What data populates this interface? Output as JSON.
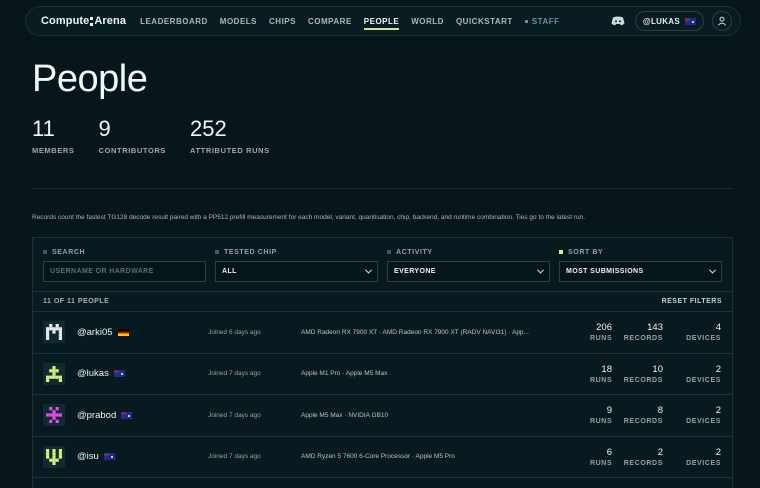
{
  "nav": {
    "brand_left": "Compute",
    "brand_right": "Arena",
    "links": [
      "LEADERBOARD",
      "MODELS",
      "CHIPS",
      "COMPARE",
      "PEOPLE",
      "WORLD",
      "QUICKSTART"
    ],
    "active": "PEOPLE",
    "staff": "STAFF",
    "user": "@LUKAS"
  },
  "header": {
    "title": "People",
    "stats": [
      {
        "value": "11",
        "label": "MEMBERS"
      },
      {
        "value": "9",
        "label": "CONTRIBUTORS"
      },
      {
        "value": "252",
        "label": "ATTRIBUTED RUNS"
      }
    ],
    "note": "Records count the fastest TG128 decode result paired with a PP512 prefill measurement for each model, variant, quantisation, chip, backend, and runtime combination. Ties go to the latest run."
  },
  "filters": {
    "search": {
      "label": "SEARCH",
      "placeholder": "USERNAME OR HARDWARE"
    },
    "chip": {
      "label": "TESTED CHIP",
      "value": "ALL"
    },
    "activity": {
      "label": "ACTIVITY",
      "value": "EVERYONE"
    },
    "sort": {
      "label": "SORT BY",
      "value": "MOST SUBMISSIONS"
    }
  },
  "list": {
    "count": "11 OF 11 PEOPLE",
    "reset": "RESET FILTERS",
    "run_label": "RUNS",
    "records_label": "RECORDS",
    "devices_label": "DEVICES",
    "rows": [
      {
        "user": "@arki05",
        "flag": "de",
        "avatar_color": "#e8ecef",
        "joined": "Joined 6 days ago",
        "hardware": "AMD Radeon RX 7900 XT · AMD Radeon RX 7900 XT (RADV NAVI31) · App...",
        "runs": "206",
        "records": "143",
        "devices": "4"
      },
      {
        "user": "@lukas",
        "flag": "au",
        "avatar_color": "#d7f07a",
        "joined": "Joined 7 days ago",
        "hardware": "Apple M1 Pro · Apple M5 Max",
        "runs": "18",
        "records": "10",
        "devices": "2"
      },
      {
        "user": "@prabod",
        "flag": "au",
        "avatar_color": "#e24de8",
        "joined": "Joined 7 days ago",
        "hardware": "Apple M5 Max · NVIDIA GB10",
        "runs": "9",
        "records": "8",
        "devices": "2"
      },
      {
        "user": "@isu",
        "flag": "au",
        "avatar_color": "#d7f07a",
        "joined": "Joined 7 days ago",
        "hardware": "AMD Ryzen 5 7600 6-Core Processor · Apple M5 Pro",
        "runs": "6",
        "records": "2",
        "devices": "2"
      }
    ]
  }
}
